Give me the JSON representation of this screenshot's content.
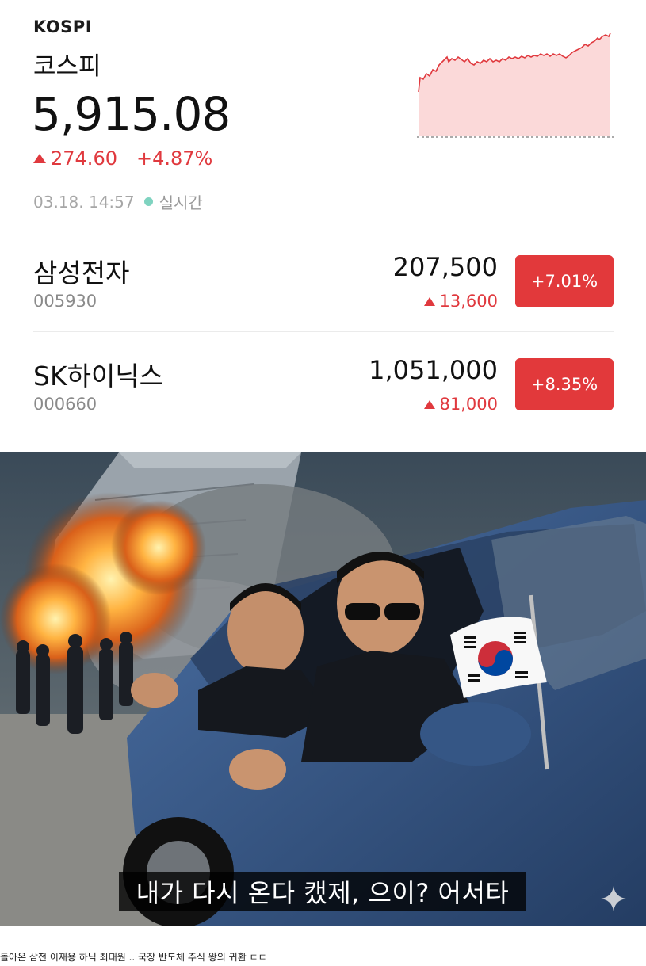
{
  "index": {
    "code": "KOSPI",
    "name": "코스피",
    "value": "5,915.08",
    "change": "274.60",
    "change_pct": "+4.87%",
    "timestamp": "03.18. 14:57",
    "live_label": "실시간"
  },
  "stocks": [
    {
      "name": "삼성전자",
      "code": "005930",
      "price": "207,500",
      "change": "13,600",
      "change_pct": "+7.01%"
    },
    {
      "name": "SK하이닉스",
      "code": "000660",
      "price": "1,051,000",
      "change": "81,000",
      "change_pct": "+8.35%"
    }
  ],
  "photo": {
    "subtitle": "내가 다시 온다 캤제, 으이? 어서타"
  },
  "caption": "돌아온 삼전 이재용 하닉 최태원 .. 국장 반도체 주식 왕의 귀환 ㄷㄷ",
  "colors": {
    "up": "#e0393e",
    "badge": "#e2393b",
    "sparkline_fill": "#fbd9d9",
    "live_dot": "#7fd3c0"
  },
  "icons": [
    "up-triangle-icon",
    "live-dot-icon",
    "sparkle-icon",
    "korean-flag-icon"
  ]
}
